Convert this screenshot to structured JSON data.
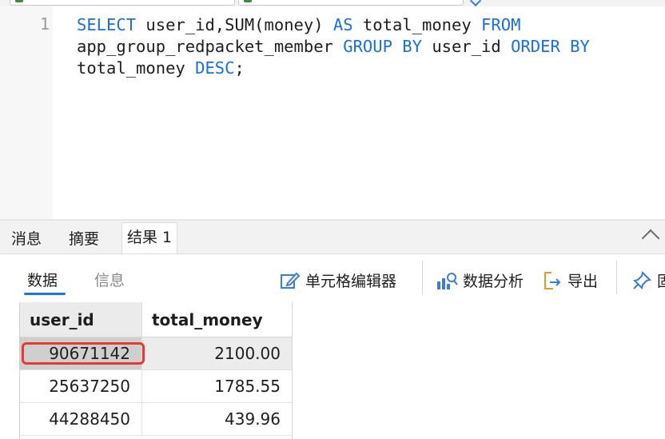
{
  "editor": {
    "line_number": "1",
    "code_segments": [
      {
        "text": "SELECT",
        "kw": true
      },
      {
        "text": " user_id,SUM(money) ",
        "kw": false
      },
      {
        "text": "AS",
        "kw": true
      },
      {
        "text": " total_money ",
        "kw": false
      },
      {
        "text": "FROM",
        "kw": true
      },
      {
        "text": "\napp_group_redpacket_member ",
        "kw": false
      },
      {
        "text": "GROUP BY",
        "kw": true
      },
      {
        "text": " user_id ",
        "kw": false
      },
      {
        "text": "ORDER BY",
        "kw": true
      },
      {
        "text": "\ntotal_money ",
        "kw": false
      },
      {
        "text": "DESC",
        "kw": true
      },
      {
        "text": ";",
        "kw": false
      }
    ]
  },
  "result_tabs": [
    {
      "label": "消息",
      "active": false
    },
    {
      "label": "摘要",
      "active": false
    },
    {
      "label": "结果 1",
      "active": true
    }
  ],
  "subtabs": {
    "data": "数据",
    "info": "信息"
  },
  "toolbar": {
    "cell_editor": "单元格编辑器",
    "data_analysis": "数据分析",
    "export": "导出",
    "pin_partial": "固"
  },
  "grid": {
    "columns": [
      "user_id",
      "total_money"
    ],
    "rows": [
      [
        "90671142",
        "2100.00"
      ],
      [
        "25637250",
        "1785.55"
      ],
      [
        "44288450",
        "439.96"
      ]
    ]
  },
  "colors": {
    "keyword": "#1a6fd8",
    "accent": "#1a73e8",
    "highlight": "#e53935"
  }
}
